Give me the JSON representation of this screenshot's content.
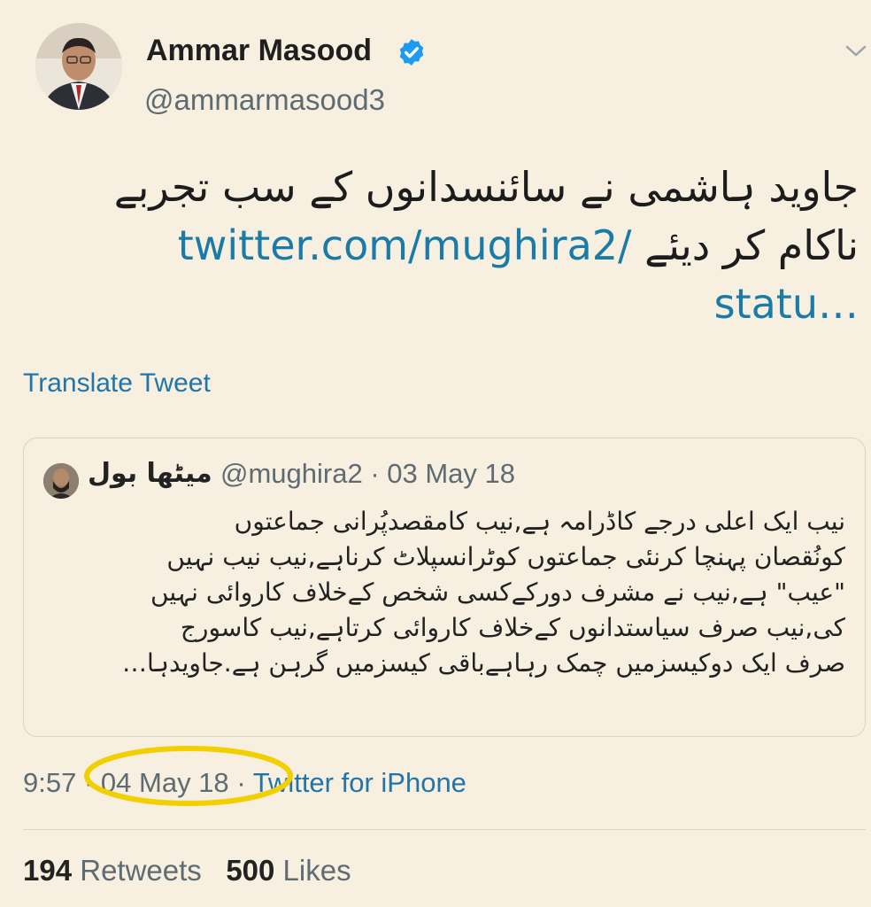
{
  "tweet": {
    "author": {
      "name": "Ammar Masood",
      "handle": "@ammarmasood3"
    },
    "text_line1": "جاوید ہاشمی نے سائنسدانوں کے سب تجربے",
    "text_line2": "ناکام کر دیئے",
    "link_part1": "twitter.com/mughira2/",
    "link_part2": "statu…",
    "translate_label": "Translate Tweet",
    "time": "9:57",
    "date": "04 May 18",
    "separator": "·",
    "source": "Twitter for iPhone",
    "retweets_count": "194",
    "retweets_label": "Retweets",
    "likes_count": "500",
    "likes_label": "Likes",
    "highlight_color": "#f2cf00"
  },
  "quoted": {
    "name": "میٹھا بول",
    "handle_date": "@mughira2 · 03 May 18",
    "lines": [
      "نیب ایک اعلی درجے کاڈرامہ ہے,نیب کامقصدپُرانی جماعتوں",
      "کونُقصان پہنچا کرنئی جماعتوں کوٹرانسپلاٹ کرناہے,نیب نیب نہیں",
      "\"عیب\" ہے,نیب نے مشرف دورکےکسی شخص کےخلاف کاروائی نہیں",
      "کی,نیب صرف سیاستدانوں کےخلاف کاروائی کرتاہے,نیب کاسورج",
      "صرف ایک دوکیسزمیں چمک رہاہےباقی کیسزمیں گرہن ہے.جاویدہا…"
    ]
  },
  "icons": {
    "verified": "verified-badge-icon",
    "chevron": "chevron-down-icon"
  }
}
